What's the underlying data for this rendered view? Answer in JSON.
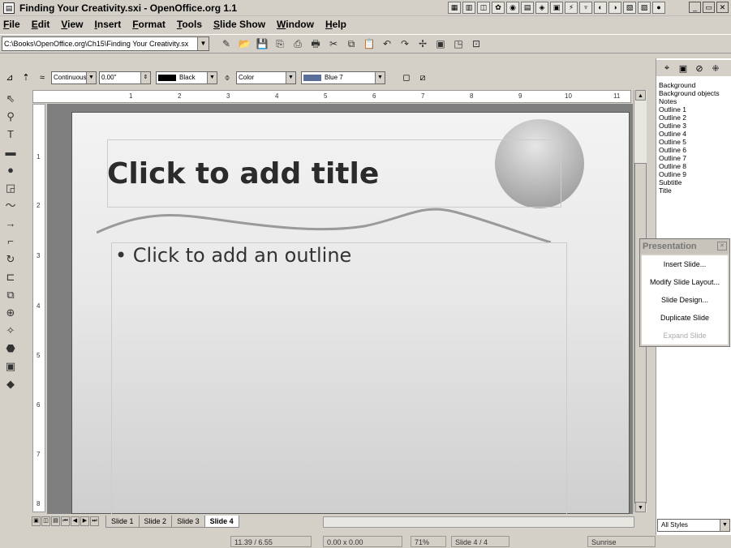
{
  "window": {
    "title": "Finding Your Creativity.sxi - OpenOffice.org 1.1",
    "app_icon": "app-icon"
  },
  "menu": [
    "File",
    "Edit",
    "View",
    "Insert",
    "Format",
    "Tools",
    "Slide Show",
    "Window",
    "Help"
  ],
  "func_bar": {
    "url": "C:\\Books\\OpenOffice.org\\Ch15\\Finding Your Creativity.sx"
  },
  "object_bar": {
    "line_style": "Continuous",
    "line_width": "0.00\"",
    "line_color": "Black",
    "area_style": "Color",
    "area_color": "Blue 7"
  },
  "slide": {
    "title_placeholder": "Click to add title",
    "outline_placeholder": "• Click to add an outline"
  },
  "horizontal_ruler_ticks": [
    "1",
    "2",
    "3",
    "4",
    "5",
    "6",
    "7",
    "8",
    "9",
    "10",
    "11"
  ],
  "vertical_ruler_ticks": [
    "1",
    "2",
    "3",
    "4",
    "5",
    "6",
    "7",
    "8"
  ],
  "tabs": [
    {
      "label": "Slide 1",
      "active": false
    },
    {
      "label": "Slide 2",
      "active": false
    },
    {
      "label": "Slide 3",
      "active": false
    },
    {
      "label": "Slide 4",
      "active": true
    }
  ],
  "status": {
    "position": "11.39 / 6.55",
    "size": "0.00 x 0.00",
    "zoom": "71%",
    "slide": "Slide 4 / 4",
    "layout": "Sunrise"
  },
  "stylist": {
    "styles": [
      "Background",
      "Background objects",
      "Notes",
      "Outline 1",
      "Outline 2",
      "Outline 3",
      "Outline 4",
      "Outline 5",
      "Outline 6",
      "Outline 7",
      "Outline 8",
      "Outline 9",
      "Subtitle",
      "Title"
    ],
    "filter": "All Styles"
  },
  "presentation": {
    "title": "Presentation",
    "items": [
      {
        "label": "Insert Slide...",
        "enabled": true
      },
      {
        "label": "Modify Slide Layout...",
        "enabled": true
      },
      {
        "label": "Slide Design...",
        "enabled": true
      },
      {
        "label": "Duplicate Slide",
        "enabled": true
      },
      {
        "label": "Expand Slide",
        "enabled": false
      }
    ]
  }
}
